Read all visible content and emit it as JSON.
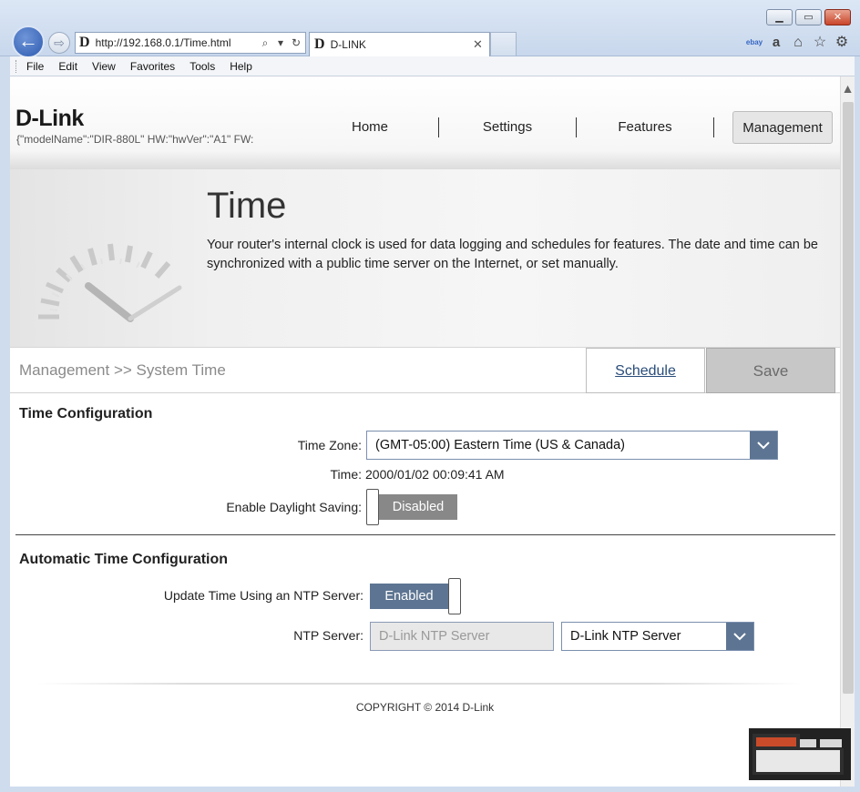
{
  "browser": {
    "address_url": "http://192.168.0.1/Time.html",
    "tab_title": "D-LINK",
    "logo_letter": "D",
    "menu": [
      "File",
      "Edit",
      "View",
      "Favorites",
      "Tools",
      "Help"
    ],
    "toolbar_icons": [
      "ebay-icon",
      "amazon-icon",
      "home-icon",
      "favorites-star-icon",
      "settings-gear-icon"
    ],
    "ebay_label": "ebay",
    "amazon_label": "a"
  },
  "header": {
    "brand": "D-Link",
    "model_text": "{\"modelName\":\"DIR-880L\"   HW:\"hwVer\":\"A1\"   FW:",
    "nav": [
      "Home",
      "Settings",
      "Features",
      "Management"
    ],
    "active_nav": "Management"
  },
  "hero": {
    "title": "Time",
    "description": "Your router's internal clock is used for data logging and schedules for features. The date and time can be synchronized with a public time server on the Internet, or set manually."
  },
  "breadcrumb": "Management >> System Time",
  "actions": {
    "schedule_label": "Schedule",
    "save_label": "Save"
  },
  "time_config": {
    "section_title": "Time Configuration",
    "time_zone_label": "Time Zone:",
    "time_zone_value": "(GMT-05:00) Eastern Time (US & Canada)",
    "time_label": "Time:",
    "time_value": "2000/01/02 00:09:41 AM",
    "daylight_label": "Enable Daylight Saving:",
    "daylight_value": "Disabled"
  },
  "auto_config": {
    "section_title": "Automatic Time Configuration",
    "ntp_update_label": "Update Time Using an NTP Server:",
    "ntp_update_value": "Enabled",
    "ntp_server_label": "NTP Server:",
    "ntp_server_input_placeholder": "D-Link NTP Server",
    "ntp_server_select_value": "D-Link NTP Server"
  },
  "footer": {
    "copyright": "COPYRIGHT © 2014 D-Link"
  },
  "colors": {
    "accent_blue": "#5d7592",
    "disabled_gray": "#888888",
    "save_gray": "#c7c7c7"
  }
}
